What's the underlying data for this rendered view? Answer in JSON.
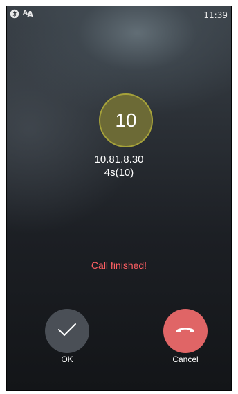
{
  "status_bar": {
    "bluetooth_icon": "bluetooth-icon",
    "font_size_icon": "font-size-icon",
    "time": "11:39"
  },
  "call": {
    "avatar_text": "10",
    "remote_address": "10.81.8.30",
    "duration": "4s(10)",
    "status_text": "Call finished!",
    "status_color": "#ff5f63",
    "avatar_color": "#6c6a36"
  },
  "actions": {
    "ok": {
      "label": "OK",
      "icon": "checkmark-icon",
      "color": "#4a4f56"
    },
    "cancel": {
      "label": "Cancel",
      "icon": "hangup-icon",
      "color": "#e06566"
    }
  }
}
